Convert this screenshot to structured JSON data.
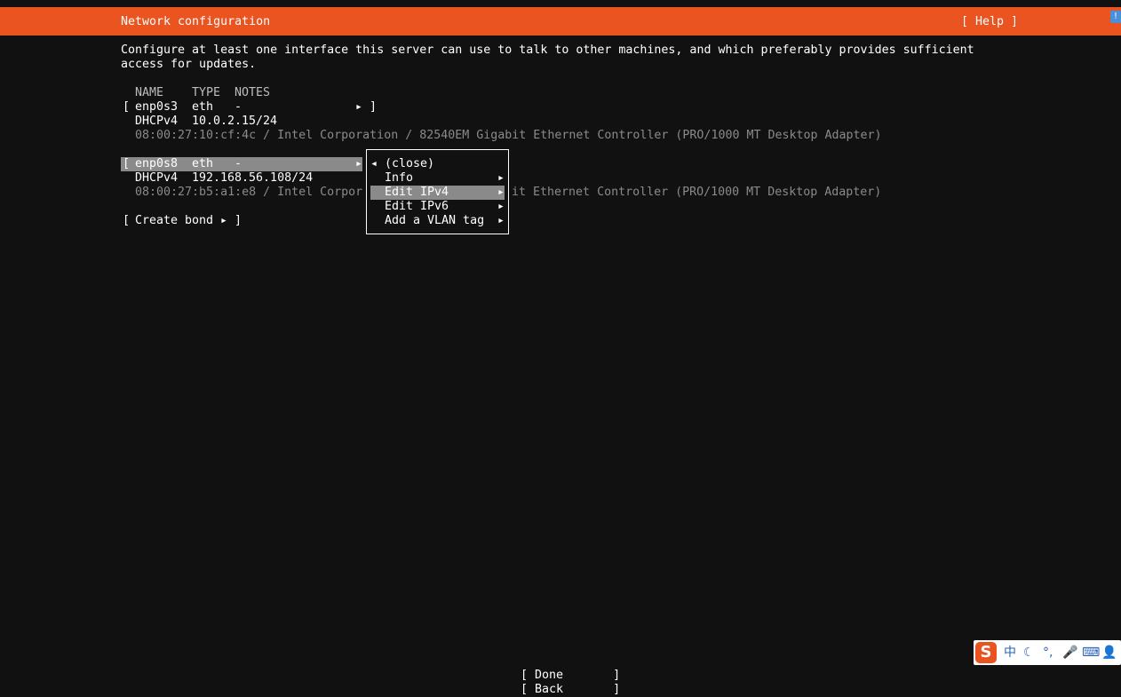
{
  "header": {
    "title": "Network configuration",
    "help": "[ Help ]"
  },
  "description": {
    "line1": "Configure at least one interface this server can use to talk to other machines, and which preferably provides sufficient",
    "line2": "access for updates."
  },
  "table": {
    "columns": [
      "NAME",
      "TYPE",
      "NOTES"
    ],
    "interfaces": [
      {
        "row_prefix": "[",
        "name": "enp0s3",
        "type": "eth",
        "notes": "-",
        "arrow": "▸",
        "row_suffix": "]",
        "proto": "DHCPv4",
        "address": "10.0.2.15/24",
        "hw": "08:00:27:10:cf:4c / Intel Corporation / 82540EM Gigabit Ethernet Controller (PRO/1000 MT Desktop Adapter)"
      },
      {
        "row_prefix": "[",
        "name": "enp0s8",
        "type": "eth",
        "notes": "-",
        "arrow": "▸",
        "proto": "DHCPv4",
        "address": "192.168.56.108/24",
        "hw_left": "08:00:27:b5:a1:e8 / Intel Corpor",
        "hw_right": "it Ethernet Controller (PRO/1000 MT Desktop Adapter)"
      }
    ]
  },
  "create_bond": {
    "open": "[",
    "label": "Create bond",
    "arrow": "▸",
    "close": "]"
  },
  "context_menu": {
    "close_arrow": "◂",
    "items": [
      {
        "label": "(close)",
        "arrow": ""
      },
      {
        "label": "Info",
        "arrow": "▸"
      },
      {
        "label": "Edit IPv4",
        "arrow": "▸",
        "selected": true
      },
      {
        "label": "Edit IPv6",
        "arrow": "▸"
      },
      {
        "label": "Add a VLAN tag",
        "arrow": "▸"
      }
    ]
  },
  "footer": {
    "done": "[ Done       ]",
    "back": "[ Back       ]"
  },
  "ime_toolbar": {
    "logo": "S",
    "items": [
      "中",
      "☾",
      "°,",
      "🎤",
      "⌨",
      "👤"
    ]
  },
  "colors": {
    "header_bg": "#e95420",
    "background": "#111111",
    "selection": "#8a8a8a",
    "dim_text": "#8a8a8a"
  }
}
